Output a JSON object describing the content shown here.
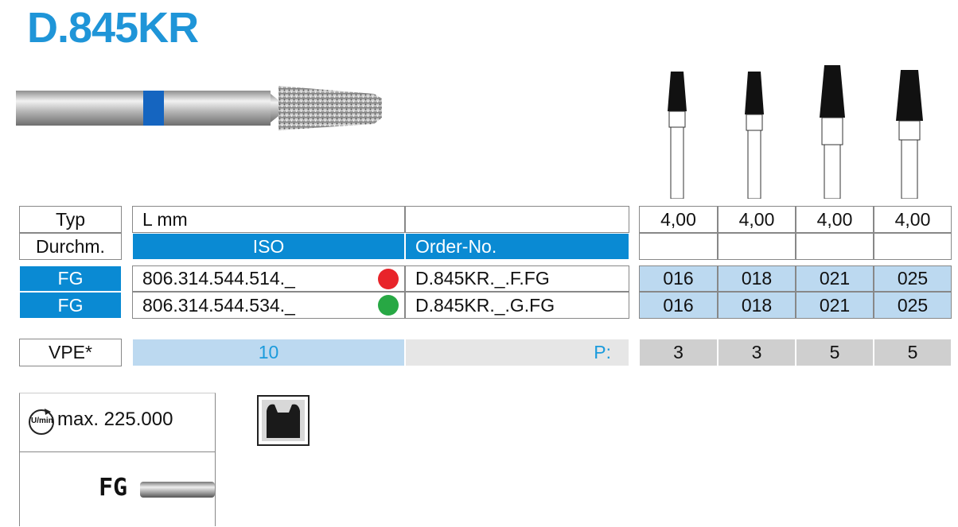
{
  "title": "D.845KR",
  "table": {
    "typ_label": "Typ",
    "lmm_label": "L mm",
    "durchm_label": "Durchm.",
    "iso_header": "ISO",
    "order_header": "Order-No.",
    "lengths": [
      "4,00",
      "4,00",
      "4,00",
      "4,00"
    ],
    "rows": [
      {
        "type": "FG",
        "iso": "806.314.544.514._",
        "dot_color": "#e8242a",
        "order": "D.845KR._.F.FG",
        "sizes": [
          "016",
          "018",
          "021",
          "025"
        ]
      },
      {
        "type": "FG",
        "iso": "806.314.544.534._",
        "dot_color": "#27a844",
        "order": "D.845KR._.G.FG",
        "sizes": [
          "016",
          "018",
          "021",
          "025"
        ]
      }
    ],
    "vpe_label": "VPE*",
    "vpe_value": "10",
    "p_label": "P:",
    "p_values": [
      "3",
      "3",
      "5",
      "5"
    ]
  },
  "speed": {
    "icon_text": "U/min",
    "label": "max. 225.000"
  },
  "shank": {
    "label": "FG"
  }
}
